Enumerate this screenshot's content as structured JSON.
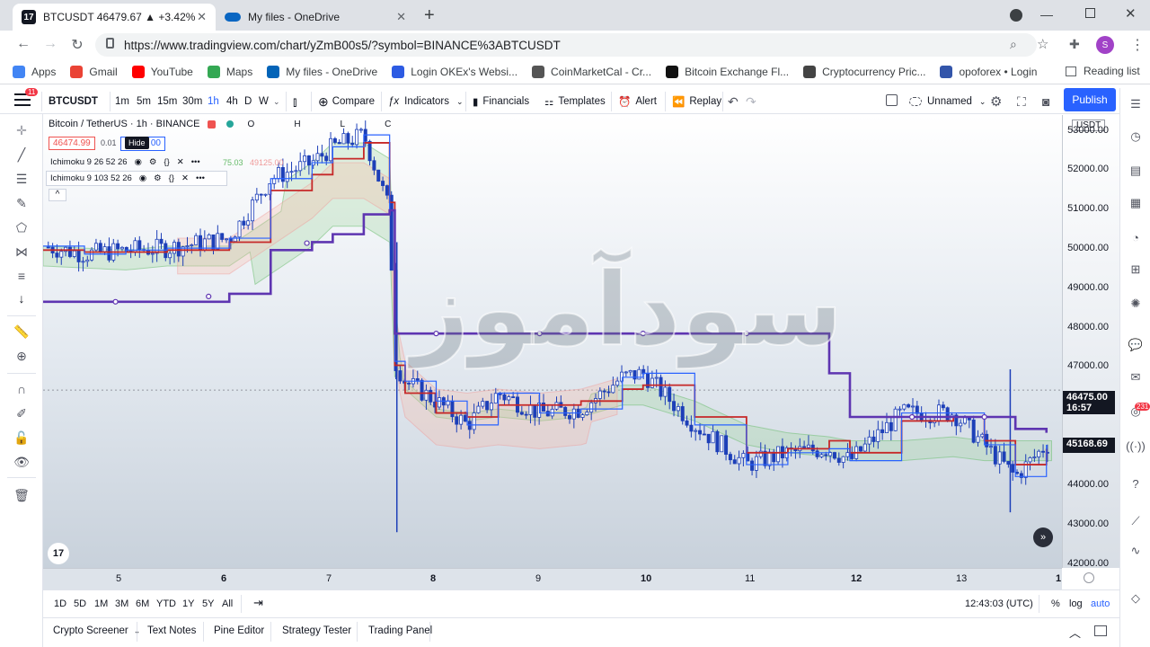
{
  "browser": {
    "tabs": [
      {
        "title": "BTCUSDT 46479.67 ▲ +3.42% Ur",
        "active": true,
        "icon": "tradingview-icon"
      },
      {
        "title": "My files - OneDrive",
        "active": false,
        "icon": "onedrive-icon"
      }
    ],
    "new_tab_label": "+",
    "url": "https://www.tradingview.com/chart/yZmB00s5/?symbol=BINANCE%3ABTCUSDT",
    "profile_initial": "S",
    "bookmarks": [
      {
        "label": "Apps",
        "color": "#4285f4"
      },
      {
        "label": "Gmail",
        "color": "#ea4335"
      },
      {
        "label": "YouTube",
        "color": "#ff0000"
      },
      {
        "label": "Maps",
        "color": "#34a853"
      },
      {
        "label": "My files - OneDrive",
        "color": "#0364b8"
      },
      {
        "label": "Login OKEx's Websi...",
        "color": "#2d5be3"
      },
      {
        "label": "CoinMarketCal - Cr...",
        "color": "#555555"
      },
      {
        "label": "Bitcoin Exchange Fl...",
        "color": "#111111"
      },
      {
        "label": "Cryptocurrency Pric...",
        "color": "#444444"
      },
      {
        "label": "opoforex • Login",
        "color": "#3355aa"
      }
    ],
    "reading_list": "Reading list"
  },
  "tv": {
    "notification_count": "11",
    "symbol": "BTCUSDT",
    "intervals": [
      "1m",
      "5m",
      "15m",
      "30m",
      "1h",
      "4h",
      "D",
      "W"
    ],
    "compare": "Compare",
    "indicators": "Indicators",
    "financials": "Financials",
    "templates": "Templates",
    "alert": "Alert",
    "replay": "Replay",
    "layout_name": "Unnamed",
    "publish": "Publish",
    "legend": {
      "title": "Bitcoin / TetherUS · 1h · BINANCE",
      "ohlc": [
        "O",
        "H",
        "L",
        "C"
      ],
      "sell_price": "46474.99",
      "spread": "0.01",
      "hide_tooltip": "Hide",
      "buy_price_fragment": "00",
      "ind1": "Ichimoku 9 26 52 26",
      "ind1_values": [
        "75.03",
        "49125.00"
      ],
      "ind2": "Ichimoku 9 103 52 26",
      "collapse": "^"
    },
    "currency": "USDT",
    "price_labels": [
      "53000.00",
      "52000.00",
      "51000.00",
      "50000.00",
      "49000.00",
      "48000.00",
      "47000.00",
      "46000.00",
      "45000.00",
      "44000.00",
      "43000.00",
      "42000.00"
    ],
    "last_price": "46475.00",
    "countdown": "16:57",
    "baseline_price": "45168.69",
    "alert_badge": "231",
    "time_labels": [
      "5",
      "6",
      "7",
      "8",
      "9",
      "10",
      "11",
      "12",
      "13",
      "1"
    ],
    "watermark_text": "سودآموز",
    "ranges": [
      "1D",
      "5D",
      "1M",
      "3M",
      "6M",
      "YTD",
      "1Y",
      "5Y",
      "All"
    ],
    "clock": "12:43:03 (UTC)",
    "axis_opts": [
      "%",
      "log",
      "auto"
    ],
    "bottom_tabs": [
      "Crypto Screener",
      "Text Notes",
      "Pine Editor",
      "Strategy Tester",
      "Trading Panel"
    ],
    "colors": {
      "accent": "#2962ff",
      "up": "#ffffff",
      "down": "#1d3fb8",
      "conversion": "#2962ff",
      "base": "#c62828",
      "purple": "#5e35b1",
      "cloud_green": "#a5d6a7",
      "cloud_red": "#f8b9a5"
    }
  },
  "chart_data": {
    "type": "line",
    "title": "Bitcoin / TetherUS · 1h · BINANCE",
    "xlabel": "",
    "ylabel": "",
    "ylim": [
      42000,
      53400
    ],
    "x": [
      "4.2",
      "4.6",
      "5",
      "5.4",
      "6",
      "6.4",
      "6.8",
      "7",
      "7.3",
      "7.55",
      "7.6",
      "7.7",
      "8",
      "8.3",
      "8.6",
      "9",
      "9.4",
      "9.8",
      "10",
      "10.5",
      "11",
      "11.4",
      "11.8",
      "12",
      "12.5",
      "13",
      "13.3",
      "13.6",
      "13.9"
    ],
    "series": [
      {
        "values": [
          50100,
          49900,
          50000,
          50050,
          50300,
          51800,
          52200,
          52600,
          52900,
          51000,
          47200,
          46700,
          46200,
          45600,
          46400,
          45900,
          46000,
          46800,
          46900,
          45600,
          44600,
          44900,
          45000,
          44700,
          45900,
          45900,
          45100,
          44300,
          45100
        ]
      },
      {
        "values": [
          50000,
          49950,
          49950,
          50000,
          50200,
          51500,
          51900,
          52300,
          52700,
          51200,
          47100,
          46400,
          45900,
          45800,
          46100,
          46100,
          46200,
          46500,
          46600,
          45800,
          44900,
          45000,
          45200,
          44900,
          45700,
          45800,
          45200,
          44600,
          45000
        ]
      },
      {
        "values": [
          50100,
          50050,
          50000,
          50100,
          50100,
          50800,
          51500,
          52000,
          52000,
          51600,
          48200,
          47000,
          46300,
          46200,
          46300,
          46200,
          46300,
          46600,
          46600,
          46200,
          45600,
          45400,
          45300,
          45200,
          45200,
          45300,
          45200,
          45200,
          45200
        ]
      },
      {
        "values": [
          48700,
          48700,
          48700,
          48700,
          48900,
          50000,
          50200,
          50400,
          50900,
          51000,
          47900,
          47900,
          47900,
          47900,
          47900,
          47900,
          47900,
          47900,
          47900,
          47900,
          47900,
          47900,
          46900,
          45800,
          45800,
          45800,
          45800,
          45500,
          45400
        ]
      }
    ]
  }
}
